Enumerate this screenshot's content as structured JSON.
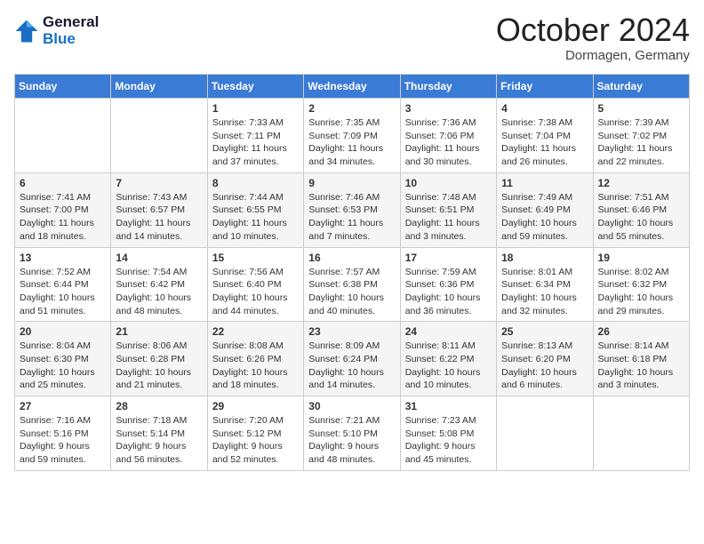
{
  "header": {
    "logo_line1": "General",
    "logo_line2": "Blue",
    "month_title": "October 2024",
    "location": "Dormagen, Germany"
  },
  "weekdays": [
    "Sunday",
    "Monday",
    "Tuesday",
    "Wednesday",
    "Thursday",
    "Friday",
    "Saturday"
  ],
  "weeks": [
    [
      {
        "day": "",
        "info": ""
      },
      {
        "day": "",
        "info": ""
      },
      {
        "day": "1",
        "info": "Sunrise: 7:33 AM\nSunset: 7:11 PM\nDaylight: 11 hours\nand 37 minutes."
      },
      {
        "day": "2",
        "info": "Sunrise: 7:35 AM\nSunset: 7:09 PM\nDaylight: 11 hours\nand 34 minutes."
      },
      {
        "day": "3",
        "info": "Sunrise: 7:36 AM\nSunset: 7:06 PM\nDaylight: 11 hours\nand 30 minutes."
      },
      {
        "day": "4",
        "info": "Sunrise: 7:38 AM\nSunset: 7:04 PM\nDaylight: 11 hours\nand 26 minutes."
      },
      {
        "day": "5",
        "info": "Sunrise: 7:39 AM\nSunset: 7:02 PM\nDaylight: 11 hours\nand 22 minutes."
      }
    ],
    [
      {
        "day": "6",
        "info": "Sunrise: 7:41 AM\nSunset: 7:00 PM\nDaylight: 11 hours\nand 18 minutes."
      },
      {
        "day": "7",
        "info": "Sunrise: 7:43 AM\nSunset: 6:57 PM\nDaylight: 11 hours\nand 14 minutes."
      },
      {
        "day": "8",
        "info": "Sunrise: 7:44 AM\nSunset: 6:55 PM\nDaylight: 11 hours\nand 10 minutes."
      },
      {
        "day": "9",
        "info": "Sunrise: 7:46 AM\nSunset: 6:53 PM\nDaylight: 11 hours\nand 7 minutes."
      },
      {
        "day": "10",
        "info": "Sunrise: 7:48 AM\nSunset: 6:51 PM\nDaylight: 11 hours\nand 3 minutes."
      },
      {
        "day": "11",
        "info": "Sunrise: 7:49 AM\nSunset: 6:49 PM\nDaylight: 10 hours\nand 59 minutes."
      },
      {
        "day": "12",
        "info": "Sunrise: 7:51 AM\nSunset: 6:46 PM\nDaylight: 10 hours\nand 55 minutes."
      }
    ],
    [
      {
        "day": "13",
        "info": "Sunrise: 7:52 AM\nSunset: 6:44 PM\nDaylight: 10 hours\nand 51 minutes."
      },
      {
        "day": "14",
        "info": "Sunrise: 7:54 AM\nSunset: 6:42 PM\nDaylight: 10 hours\nand 48 minutes."
      },
      {
        "day": "15",
        "info": "Sunrise: 7:56 AM\nSunset: 6:40 PM\nDaylight: 10 hours\nand 44 minutes."
      },
      {
        "day": "16",
        "info": "Sunrise: 7:57 AM\nSunset: 6:38 PM\nDaylight: 10 hours\nand 40 minutes."
      },
      {
        "day": "17",
        "info": "Sunrise: 7:59 AM\nSunset: 6:36 PM\nDaylight: 10 hours\nand 36 minutes."
      },
      {
        "day": "18",
        "info": "Sunrise: 8:01 AM\nSunset: 6:34 PM\nDaylight: 10 hours\nand 32 minutes."
      },
      {
        "day": "19",
        "info": "Sunrise: 8:02 AM\nSunset: 6:32 PM\nDaylight: 10 hours\nand 29 minutes."
      }
    ],
    [
      {
        "day": "20",
        "info": "Sunrise: 8:04 AM\nSunset: 6:30 PM\nDaylight: 10 hours\nand 25 minutes."
      },
      {
        "day": "21",
        "info": "Sunrise: 8:06 AM\nSunset: 6:28 PM\nDaylight: 10 hours\nand 21 minutes."
      },
      {
        "day": "22",
        "info": "Sunrise: 8:08 AM\nSunset: 6:26 PM\nDaylight: 10 hours\nand 18 minutes."
      },
      {
        "day": "23",
        "info": "Sunrise: 8:09 AM\nSunset: 6:24 PM\nDaylight: 10 hours\nand 14 minutes."
      },
      {
        "day": "24",
        "info": "Sunrise: 8:11 AM\nSunset: 6:22 PM\nDaylight: 10 hours\nand 10 minutes."
      },
      {
        "day": "25",
        "info": "Sunrise: 8:13 AM\nSunset: 6:20 PM\nDaylight: 10 hours\nand 6 minutes."
      },
      {
        "day": "26",
        "info": "Sunrise: 8:14 AM\nSunset: 6:18 PM\nDaylight: 10 hours\nand 3 minutes."
      }
    ],
    [
      {
        "day": "27",
        "info": "Sunrise: 7:16 AM\nSunset: 5:16 PM\nDaylight: 9 hours\nand 59 minutes."
      },
      {
        "day": "28",
        "info": "Sunrise: 7:18 AM\nSunset: 5:14 PM\nDaylight: 9 hours\nand 56 minutes."
      },
      {
        "day": "29",
        "info": "Sunrise: 7:20 AM\nSunset: 5:12 PM\nDaylight: 9 hours\nand 52 minutes."
      },
      {
        "day": "30",
        "info": "Sunrise: 7:21 AM\nSunset: 5:10 PM\nDaylight: 9 hours\nand 48 minutes."
      },
      {
        "day": "31",
        "info": "Sunrise: 7:23 AM\nSunset: 5:08 PM\nDaylight: 9 hours\nand 45 minutes."
      },
      {
        "day": "",
        "info": ""
      },
      {
        "day": "",
        "info": ""
      }
    ]
  ]
}
